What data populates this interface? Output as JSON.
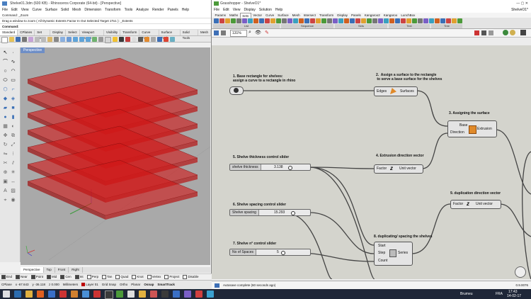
{
  "rhino": {
    "title": "Shelve01.3dm (600 KB) - Rhinoceros Corporate (64-bit) - [Perspective]",
    "menu": [
      "File",
      "Edit",
      "View",
      "Curve",
      "Surface",
      "Solid",
      "Mesh",
      "Dimension",
      "Transform",
      "Tools",
      "Analyze",
      "Render",
      "Panels",
      "Help"
    ],
    "command_history": [
      "Command: _Zoom",
      "Drag a window to zoom ( All  Dynamic  Extents  Factor  In  Out  Selected  Target  1To1 ): _Extents"
    ],
    "command_prompt": "Command:",
    "toolbar_tabs": [
      "Standard",
      "CPlanes",
      "Set View",
      "Display",
      "Select",
      "Viewport Layout",
      "Visibility",
      "Transform",
      "Curve Tools",
      "Surface Tools",
      "Solid Tools",
      "Mesh"
    ],
    "viewport_label": "Perspective",
    "view_tabs": [
      "Perspective",
      "Top",
      "Front",
      "Right"
    ],
    "osnaps": [
      {
        "label": "End",
        "on": true
      },
      {
        "label": "Near",
        "on": true
      },
      {
        "label": "Point",
        "on": true
      },
      {
        "label": "Mid",
        "on": true
      },
      {
        "label": "Cen",
        "on": true
      },
      {
        "label": "Int",
        "on": true
      },
      {
        "label": "Perp",
        "on": false
      },
      {
        "label": "Tan",
        "on": false
      },
      {
        "label": "Quad",
        "on": false
      },
      {
        "label": "Knot",
        "on": false
      },
      {
        "label": "Vertex",
        "on": false
      },
      {
        "label": "Project",
        "on": false
      },
      {
        "label": "Disable",
        "on": false
      }
    ],
    "status": {
      "cplane": "CPlane",
      "x": "x -67.643",
      "y": "y -36.118",
      "z": "z 0.000",
      "units": "Millimeters",
      "layer": "Layer 01",
      "grid_snap": "Grid Snap",
      "ortho": "Ortho",
      "planar": "Planar",
      "osnap": "Osnap",
      "smarttrack": "SmartTrack"
    },
    "shelf_color": "#d01818"
  },
  "grasshopper": {
    "title": "Grasshopper - ShelveO1*",
    "menu": [
      "File",
      "Edit",
      "View",
      "Display",
      "Solution",
      "Help"
    ],
    "doc_name": "ShelveO1*",
    "tabs": [
      "Params",
      "Maths",
      "Sets",
      "Vector",
      "Curve",
      "Surface",
      "Mesh",
      "Intersect",
      "Transform",
      "Display",
      "Panels",
      "Kangaroo2",
      "Kangaroo",
      "LunchBox"
    ],
    "active_tab": "Sets",
    "ribbon_groups": [
      "List",
      "Sequence",
      "Sets",
      "Text",
      "Tree"
    ],
    "zoom": "131%",
    "notes": {
      "n1": "1. Base rectangle for shelves:\nassign a curve to a rectangle in rhino",
      "n2": "2.  Assign a surface to the rectangle\n to serve a base surface for the shelves",
      "n3": "3. Assigning the surface",
      "n4": "4. Extrusion direction vector",
      "n5": "5. Shelve thickness control slider",
      "n6": "6. Shelve spacing control slider",
      "n7": "7. Shelve n° control slider",
      "n8": "8. duplicating/ spacing  the shelves",
      "n9": "9. duplication direction vector"
    },
    "components": {
      "boundary": {
        "in": "Edges",
        "out": "Surfaces"
      },
      "extrude": {
        "in1": "Base",
        "in2": "Direction",
        "out": "Extrusion"
      },
      "unitz1": {
        "in": "Factor",
        "out": "Unit vector"
      },
      "unitz2": {
        "in": "Factor",
        "out": "Unit vector"
      },
      "series": {
        "in1": "Start",
        "in2": "Step",
        "in3": "Count",
        "out": "Series"
      }
    },
    "sliders": {
      "thickness": {
        "label": "shelve thickness",
        "value": "3.138"
      },
      "spacing": {
        "label": "Shelve spacing",
        "value": "15.293"
      },
      "count": {
        "label": "No of Spaces",
        "value": "5"
      }
    },
    "status_message": "Autosave complete (60 seconds ago)",
    "version": "0.9.0076"
  },
  "taskbar": {
    "time": "17:43",
    "date": "14-02-17",
    "lang": "FRA",
    "weather": "Brumeu"
  }
}
